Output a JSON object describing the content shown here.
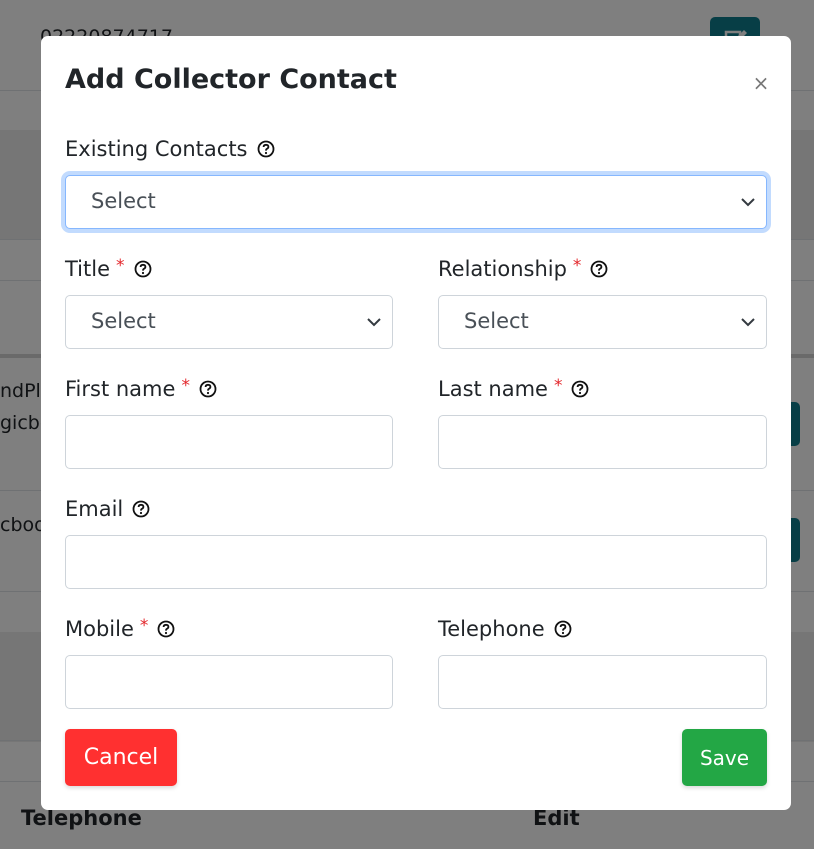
{
  "background": {
    "phone_value": "02220874717",
    "row_text_1a": "ndPl",
    "row_text_1b": "gicbo",
    "row_text_2": "cboo",
    "column_headers": [
      "Telephone",
      "Edit"
    ],
    "accent_color": "#0e7c8c"
  },
  "modal": {
    "title": "Add Collector Contact",
    "close_label": "×",
    "fields": {
      "existing_contacts": {
        "label": "Existing Contacts",
        "required": false,
        "value": "Select",
        "help_icon": "question-circle-icon"
      },
      "title": {
        "label": "Title",
        "required": true,
        "required_mark": "*",
        "value": "Select",
        "help_icon": "question-circle-icon"
      },
      "relationship": {
        "label": "Relationship",
        "required": true,
        "required_mark": "*",
        "value": "Select",
        "help_icon": "question-circle-icon"
      },
      "first_name": {
        "label": "First name",
        "required": true,
        "required_mark": "*",
        "value": "",
        "help_icon": "question-circle-icon"
      },
      "last_name": {
        "label": "Last name",
        "required": true,
        "required_mark": "*",
        "value": "",
        "help_icon": "question-circle-icon"
      },
      "email": {
        "label": "Email",
        "required": false,
        "value": "",
        "help_icon": "question-circle-icon"
      },
      "mobile": {
        "label": "Mobile",
        "required": true,
        "required_mark": "*",
        "value": "",
        "help_icon": "question-circle-icon"
      },
      "telephone": {
        "label": "Telephone",
        "required": false,
        "value": "",
        "help_icon": "question-circle-icon"
      }
    },
    "buttons": {
      "cancel_label": "Cancel",
      "save_label": "Save"
    },
    "colors": {
      "cancel": "#ff3030",
      "save": "#23a745",
      "required": "#e3262b",
      "focus": "#86b7fe"
    }
  }
}
